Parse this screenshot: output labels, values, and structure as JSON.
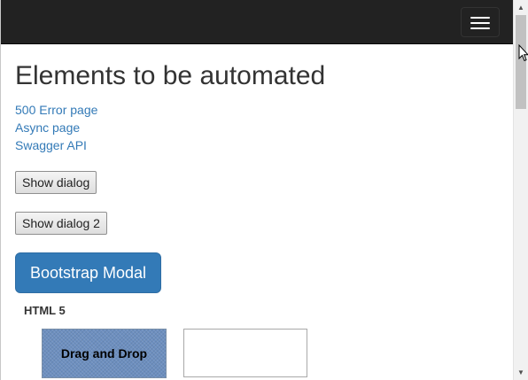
{
  "navbar": {
    "toggle_icon": "hamburger-icon"
  },
  "main": {
    "heading": "Elements to be automated",
    "links": [
      "500 Error page",
      "Async page",
      "Swagger API"
    ],
    "buttons": {
      "show_dialog": "Show dialog",
      "show_dialog_2": "Show dialog 2",
      "bootstrap_modal": "Bootstrap Modal"
    },
    "html5": {
      "heading": "HTML 5",
      "drag_label": "Drag and Drop"
    }
  },
  "colors": {
    "navbar_bg": "#222222",
    "link": "#337ab7",
    "primary_button": "#337ab7"
  }
}
